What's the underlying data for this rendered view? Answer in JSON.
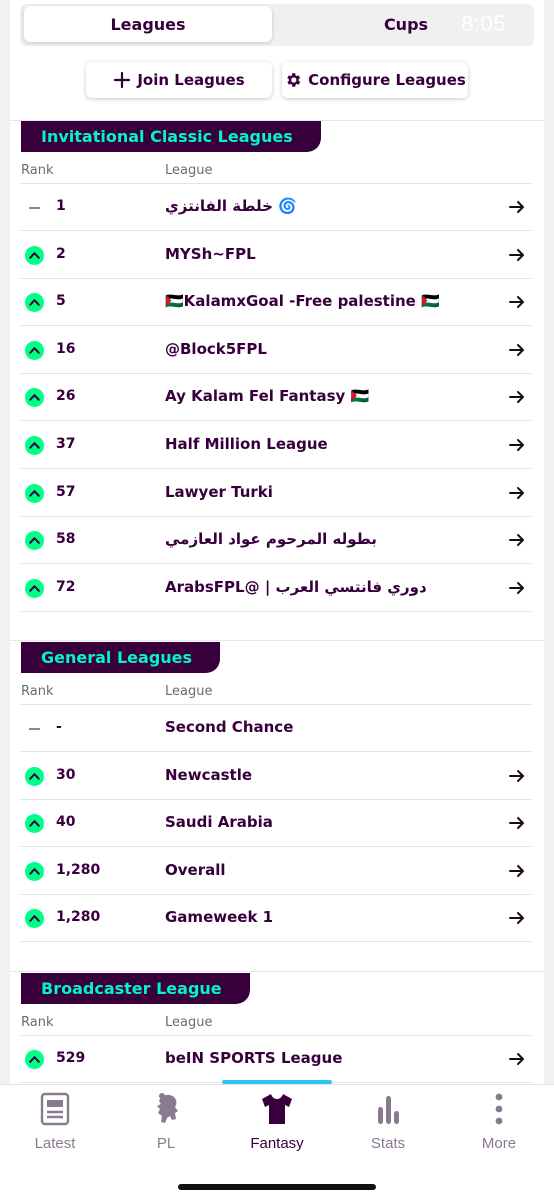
{
  "status": {
    "time": "8:05"
  },
  "segments": {
    "active": "Leagues",
    "inactive": "Cups"
  },
  "actions": {
    "join": "Join Leagues",
    "configure": "Configure Leagues"
  },
  "column_headers": {
    "rank": "Rank",
    "league": "League"
  },
  "sections": [
    {
      "title": "Invitational Classic Leagues",
      "rows": [
        {
          "move": "same",
          "rank": "1",
          "name": "خلطة الفانتزي 🌀"
        },
        {
          "move": "up",
          "rank": "2",
          "name": "MYSh~FPL"
        },
        {
          "move": "up",
          "rank": "5",
          "name": "🇵🇸KalamxGoal -Free palestine 🇵🇸"
        },
        {
          "move": "up",
          "rank": "16",
          "name": "@Block5FPL"
        },
        {
          "move": "up",
          "rank": "26",
          "name": "Ay Kalam Fel Fantasy 🇵🇸"
        },
        {
          "move": "up",
          "rank": "37",
          "name": "Half Million League"
        },
        {
          "move": "up",
          "rank": "57",
          "name": "Lawyer Turki"
        },
        {
          "move": "up",
          "rank": "58",
          "name": "بطوله المرحوم عواد العازمي"
        },
        {
          "move": "up",
          "rank": "72",
          "name": "ArabsFPL@ | دوري فانتسي العرب"
        }
      ]
    },
    {
      "title": "General Leagues",
      "rows": [
        {
          "move": "same",
          "rank": "-",
          "name": "Second Chance",
          "no_arrow": true
        },
        {
          "move": "up",
          "rank": "30",
          "name": "Newcastle"
        },
        {
          "move": "up",
          "rank": "40",
          "name": "Saudi Arabia"
        },
        {
          "move": "up",
          "rank": "1,280",
          "name": "Overall"
        },
        {
          "move": "up",
          "rank": "1,280",
          "name": "Gameweek 1"
        }
      ]
    },
    {
      "title": "Broadcaster League",
      "rows": [
        {
          "move": "up",
          "rank": "529",
          "name": "beIN SPORTS League"
        }
      ]
    }
  ],
  "nav": [
    {
      "label": "Latest",
      "icon": "newspaper-icon"
    },
    {
      "label": "PL",
      "icon": "lion-crest-icon"
    },
    {
      "label": "Fantasy",
      "icon": "shirt-icon",
      "active": true
    },
    {
      "label": "Stats",
      "icon": "bar-chart-icon"
    },
    {
      "label": "More",
      "icon": "more-vertical-icon"
    }
  ],
  "colors": {
    "primary": "#37003c",
    "accent": "#04f5c5",
    "up": "#00ff87",
    "nav_indicator": "#2ec5f2"
  }
}
